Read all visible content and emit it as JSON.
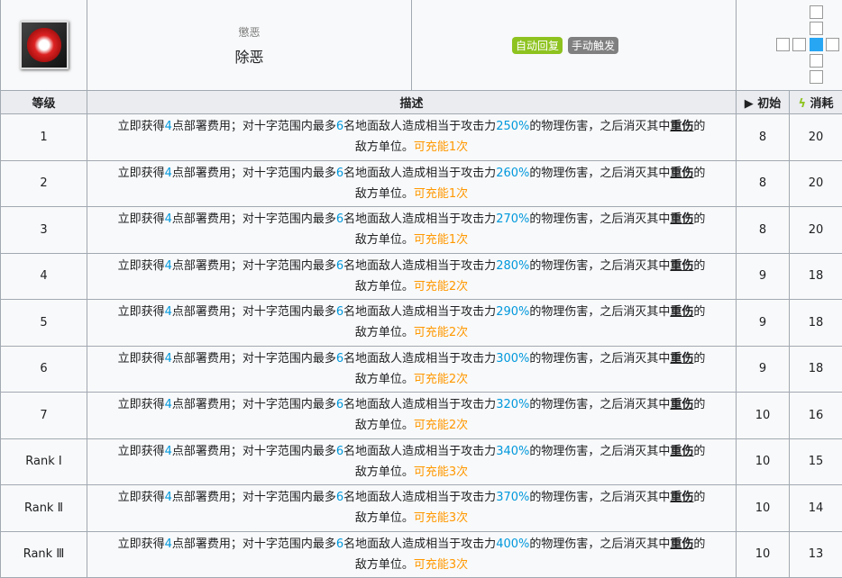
{
  "skill": {
    "subtitle": "懲恶",
    "name": "除恶",
    "icon": "skill-icon-flames",
    "tags": [
      {
        "label": "自动回复",
        "color": "#8ec31f"
      },
      {
        "label": "手动触发",
        "color": "#808080"
      }
    ]
  },
  "headers": {
    "level": "等级",
    "desc": "描述",
    "initial": "初始",
    "cost": "消耗"
  },
  "desc_parts": {
    "a": "立即获得",
    "sp": "4",
    "b": "点部署费用；对十字范围内最多",
    "n": "6",
    "c": "名地面敌人造成相当于攻击力",
    "d": "的物理伤害，之后消灭其中",
    "kw": "重伤",
    "e": "的",
    "f": "敌方单位。"
  },
  "rows": [
    {
      "level": "1",
      "pct": "250%",
      "charge": "可充能1次",
      "init": "8",
      "cost": "20"
    },
    {
      "level": "2",
      "pct": "260%",
      "charge": "可充能1次",
      "init": "8",
      "cost": "20"
    },
    {
      "level": "3",
      "pct": "270%",
      "charge": "可充能1次",
      "init": "8",
      "cost": "20"
    },
    {
      "level": "4",
      "pct": "280%",
      "charge": "可充能2次",
      "init": "9",
      "cost": "18"
    },
    {
      "level": "5",
      "pct": "290%",
      "charge": "可充能2次",
      "init": "9",
      "cost": "18"
    },
    {
      "level": "6",
      "pct": "300%",
      "charge": "可充能2次",
      "init": "9",
      "cost": "18"
    },
    {
      "level": "7",
      "pct": "320%",
      "charge": "可充能2次",
      "init": "10",
      "cost": "16"
    },
    {
      "level": "Rank Ⅰ",
      "pct": "340%",
      "charge": "可充能3次",
      "init": "10",
      "cost": "15"
    },
    {
      "level": "Rank Ⅱ",
      "pct": "370%",
      "charge": "可充能3次",
      "init": "10",
      "cost": "14"
    },
    {
      "level": "Rank Ⅲ",
      "pct": "400%",
      "charge": "可充能3次",
      "init": "10",
      "cost": "13"
    }
  ]
}
